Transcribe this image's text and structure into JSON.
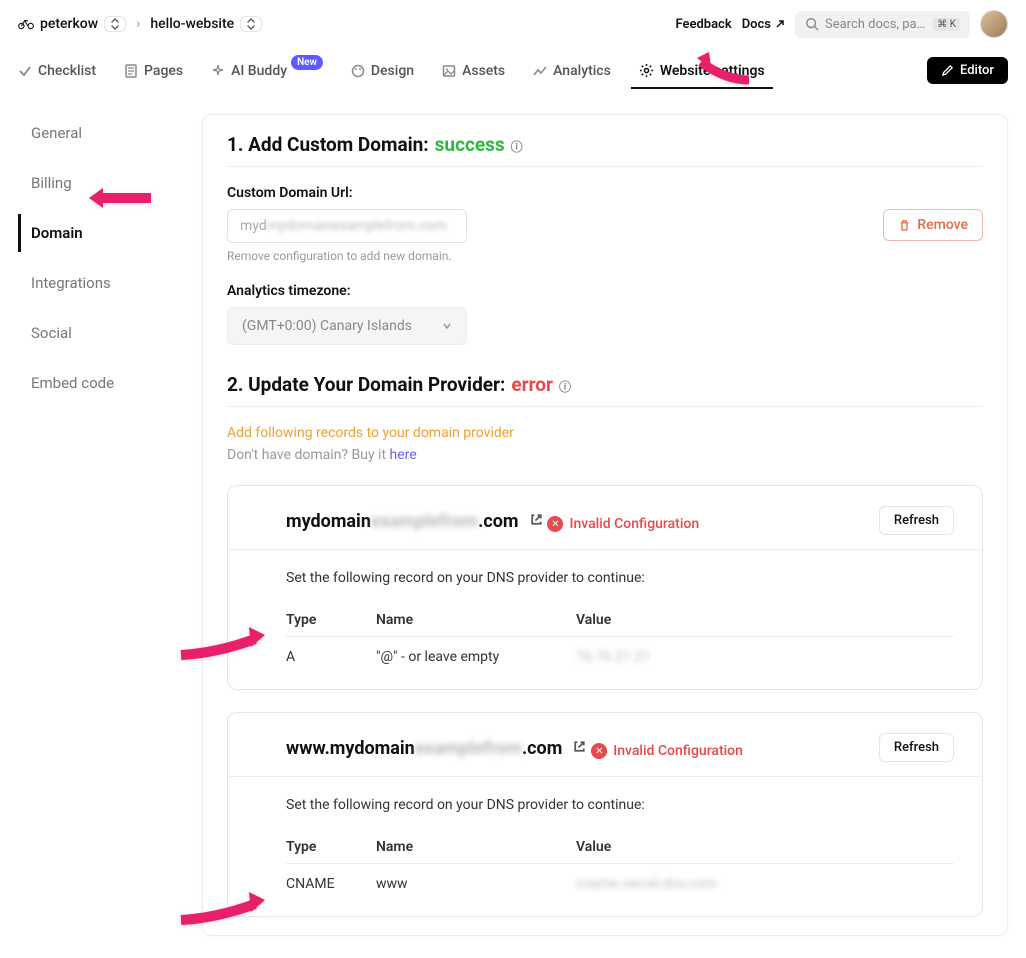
{
  "topbar": {
    "crumb1": "peterkow",
    "crumb2": "hello-website",
    "feedback": "Feedback",
    "docs": "Docs",
    "search_placeholder": "Search docs, pages etc",
    "search_kbd": "⌘ K"
  },
  "tabs": {
    "checklist": "Checklist",
    "pages": "Pages",
    "aibuddy": "AI Buddy",
    "new_badge": "New",
    "design": "Design",
    "assets": "Assets",
    "analytics": "Analytics",
    "settings": "Website settings",
    "editor": "Editor"
  },
  "sidebar": {
    "items": [
      "General",
      "Billing",
      "Domain",
      "Integrations",
      "Social",
      "Embed code"
    ],
    "active_index": 2
  },
  "section1": {
    "prefix": "1. Add Custom Domain:",
    "status": "success",
    "domain_label": "Custom Domain Url:",
    "domain_value": "mydomainexamplefrom.com",
    "hint": "Remove configuration to add new domain.",
    "remove": "Remove",
    "tz_label": "Analytics timezone:",
    "tz_value": "(GMT+0:00) Canary Islands"
  },
  "section2": {
    "prefix": "2. Update Your Domain Provider:",
    "status": "error",
    "warn": "Add following records to your domain provider",
    "nohave": "Don't have domain? Buy it ",
    "here": "here"
  },
  "dns": {
    "refresh": "Refresh",
    "invalid": "Invalid Configuration",
    "instruct": "Set the following record on your DNS provider to continue:",
    "col_type": "Type",
    "col_name": "Name",
    "col_value": "Value",
    "card1": {
      "title_clear1": "mydomain",
      "title_blur": "examplefrom",
      "title_clear2": ".com",
      "rec_type": "A",
      "rec_name": "\"@\" - or leave empty",
      "rec_value": "76.76.21.21"
    },
    "card2": {
      "title_clear1": "www.mydomain",
      "title_blur": "examplefrom",
      "title_clear2": ".com",
      "rec_type": "CNAME",
      "rec_name": "www",
      "rec_value": "cname.vercel-dns.com"
    }
  }
}
